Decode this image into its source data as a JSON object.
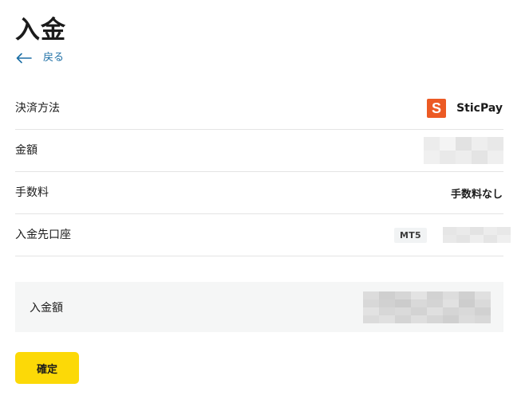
{
  "header": {
    "title": "入金",
    "back_label": "戻る"
  },
  "details": {
    "payment_method": {
      "label": "決済方法",
      "value": "SticPay",
      "logo_letter": "S"
    },
    "amount": {
      "label": "金額"
    },
    "fee": {
      "label": "手数料",
      "value": "手数料なし"
    },
    "deposit_account": {
      "label": "入金先口座",
      "platform_badge": "MT5"
    }
  },
  "summary": {
    "label": "入金額"
  },
  "actions": {
    "confirm_label": "確定"
  },
  "colors": {
    "accent_yellow": "#fcd907",
    "link_blue": "#1d6fa5",
    "sticpay_orange": "#ec5a24"
  }
}
